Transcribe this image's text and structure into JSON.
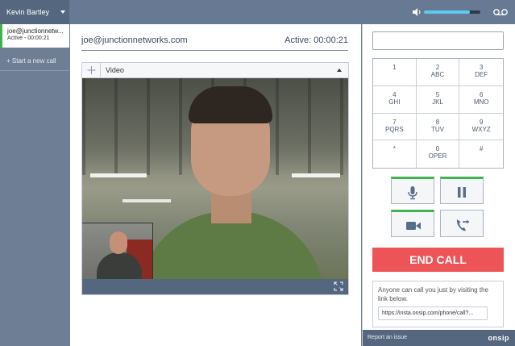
{
  "topbar": {
    "user_name": "Kevin Bartley",
    "volume_level": 0.82
  },
  "sidebar": {
    "active_call": {
      "contact": "joe@junctionnetw...",
      "status": "Active - 00:00:21"
    },
    "new_call_label": "+ Start a new call"
  },
  "call": {
    "address": "joe@junctionnetworks.com",
    "status": "Active: 00:00:21",
    "video_label": "Video"
  },
  "dialer": {
    "input_value": "",
    "keys": [
      {
        "digit": "1",
        "letters": ""
      },
      {
        "digit": "2",
        "letters": "ABC"
      },
      {
        "digit": "3",
        "letters": "DEF"
      },
      {
        "digit": "4",
        "letters": "GHI"
      },
      {
        "digit": "5",
        "letters": "JKL"
      },
      {
        "digit": "6",
        "letters": "MNO"
      },
      {
        "digit": "7",
        "letters": "PQRS"
      },
      {
        "digit": "8",
        "letters": "TUV"
      },
      {
        "digit": "9",
        "letters": "WXYZ"
      },
      {
        "digit": "*",
        "letters": ""
      },
      {
        "digit": "0",
        "letters": "OPER"
      },
      {
        "digit": "#",
        "letters": ""
      }
    ],
    "end_call_label": "END CALL",
    "share_text": "Anyone can call you just by visiting the link below.",
    "share_link": "https://insta.onsip.com/phone/call?..."
  },
  "footer": {
    "report_label": "Report an issue",
    "brand": "onsip"
  },
  "colors": {
    "accent_green": "#3fb34f",
    "end_call_red": "#ec5457",
    "sidebar_bg": "#6e7f95",
    "volume_fill": "#5fc9f3"
  },
  "icons": [
    "chevron-down-icon",
    "volume-icon",
    "voicemail-icon",
    "move-icon",
    "expand-icon",
    "microphone-icon",
    "pause-icon",
    "video-camera-icon",
    "transfer-call-icon"
  ]
}
